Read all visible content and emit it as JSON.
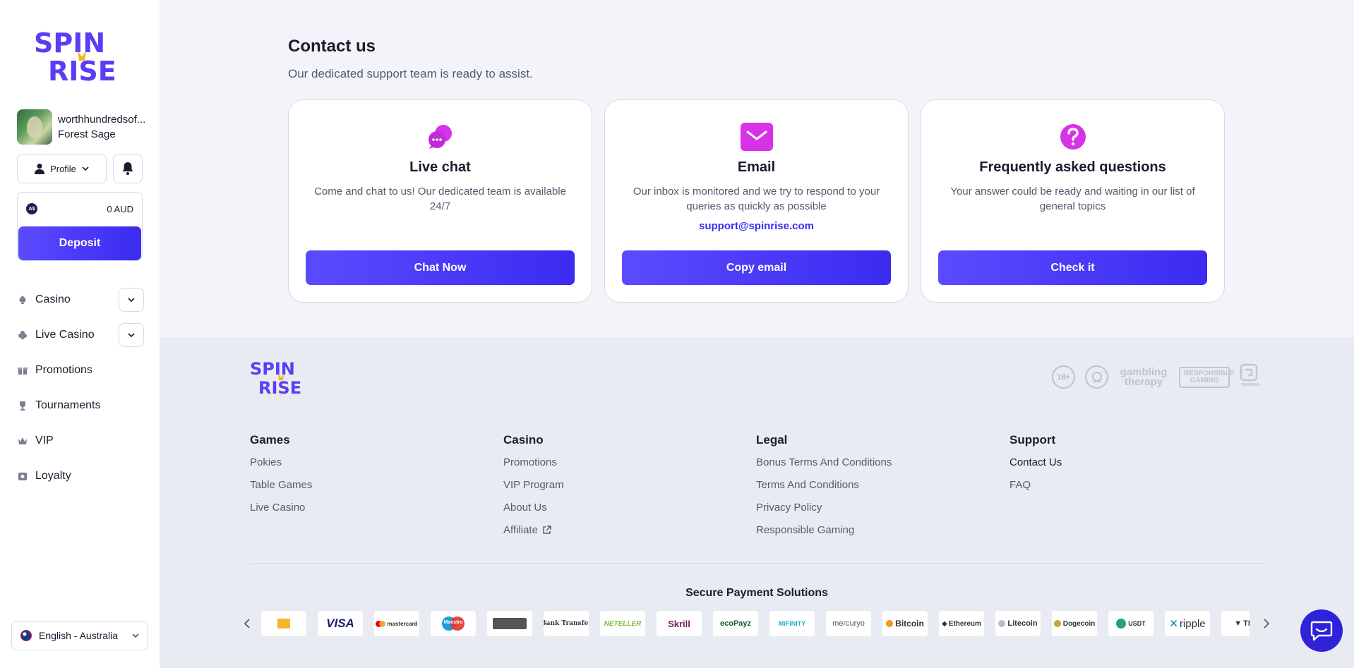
{
  "brand": {
    "logo_top": "SPIN",
    "logo_bottom": "RISE"
  },
  "user": {
    "name": "worthhundredsof...",
    "rank": "Forest Sage"
  },
  "profile_button": {
    "label": "Profile"
  },
  "wallet": {
    "currency_badge": "A$",
    "balance": "0 AUD",
    "deposit_label": "Deposit"
  },
  "nav": {
    "items": [
      {
        "label": "Casino",
        "icon": "spade-icon",
        "expandable": true
      },
      {
        "label": "Live Casino",
        "icon": "club-icon",
        "expandable": true
      },
      {
        "label": "Promotions",
        "icon": "gift-icon"
      },
      {
        "label": "Tournaments",
        "icon": "trophy-icon"
      },
      {
        "label": "VIP",
        "icon": "crown-icon"
      },
      {
        "label": "Loyalty",
        "icon": "loyalty-icon"
      }
    ]
  },
  "language": {
    "label": "English - Australia"
  },
  "contact": {
    "title": "Contact us",
    "subtitle": "Our dedicated support team is ready to assist.",
    "cards": [
      {
        "title": "Live chat",
        "text": "Come and chat to us! Our dedicated team is available 24/7",
        "button": "Chat Now"
      },
      {
        "title": "Email",
        "text": "Our inbox is monitored and we try to respond to your queries as quickly as possible",
        "email": "support@spinrise.com",
        "button": "Copy email"
      },
      {
        "title": "Frequently asked questions",
        "text": "Your answer could be ready and waiting in our list of general topics",
        "button": "Check it"
      }
    ]
  },
  "footer": {
    "badges": {
      "age": "18+",
      "gambling_therapy": "gambling therapy",
      "responsible_gaming": "RESPONSIBLE GAMING"
    },
    "columns": [
      {
        "title": "Games",
        "links": [
          "Pokies",
          "Table Games",
          "Live Casino"
        ]
      },
      {
        "title": "Casino",
        "links": [
          "Promotions",
          "VIP Program",
          "About Us",
          "Affiliate"
        ]
      },
      {
        "title": "Legal",
        "links": [
          "Bonus Terms And Conditions",
          "Terms And Conditions",
          "Privacy Policy",
          "Responsible Gaming"
        ]
      },
      {
        "title": "Support",
        "links": [
          "Contact Us",
          "FAQ"
        ]
      }
    ],
    "payments_title": "Secure Payment Solutions",
    "payments": [
      "",
      "VISA",
      "mastercard",
      "Maestro",
      "",
      "Bank Transfer",
      "NETELLER",
      "Skrill",
      "ecoPayz",
      "MiFINITY",
      "mercuryo",
      "Bitcoin",
      "Ethereum",
      "Litecoin",
      "Dogecoin",
      "USDT",
      "ripple",
      "TR"
    ]
  },
  "colors": {
    "accent": "#3b2bf0",
    "accent_light": "#5b4bff",
    "magenta": "#d632e8",
    "background": "#eef0f6"
  }
}
